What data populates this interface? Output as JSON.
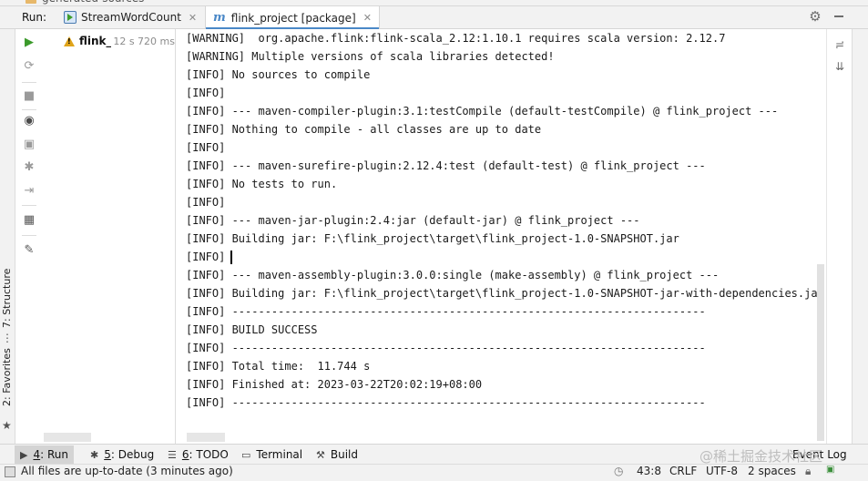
{
  "top": {
    "cut_text": "generated-sources"
  },
  "run_panel": {
    "label": "Run:",
    "tabs": [
      {
        "label": "StreamWordCount",
        "close": "✕"
      },
      {
        "label": "flink_project [package]",
        "close": "✕"
      }
    ]
  },
  "tree": {
    "name": "flink_p",
    "time": "12 s 720 ms"
  },
  "side": {
    "structure": "7: Structure",
    "favorites": "2: Favorites"
  },
  "console": {
    "lines": [
      "[WARNING]  org.apache.flink:flink-scala_2.12:1.10.1 requires scala version: 2.12.7",
      "[WARNING] Multiple versions of scala libraries detected!",
      "[INFO] No sources to compile",
      "[INFO]",
      "[INFO] --- maven-compiler-plugin:3.1:testCompile (default-testCompile) @ flink_project ---",
      "[INFO] Nothing to compile - all classes are up to date",
      "[INFO]",
      "[INFO] --- maven-surefire-plugin:2.12.4:test (default-test) @ flink_project ---",
      "[INFO] No tests to run.",
      "[INFO]",
      "[INFO] --- maven-jar-plugin:2.4:jar (default-jar) @ flink_project ---",
      "[INFO] Building jar: F:\\flink_project\\target\\flink_project-1.0-SNAPSHOT.jar",
      "[INFO]",
      "[INFO] --- maven-assembly-plugin:3.0.0:single (make-assembly) @ flink_project ---",
      "[INFO] Building jar: F:\\flink_project\\target\\flink_project-1.0-SNAPSHOT-jar-with-dependencies.jar",
      "[INFO] ------------------------------------------------------------------------",
      "[INFO] BUILD SUCCESS",
      "[INFO] ------------------------------------------------------------------------",
      "[INFO] Total time:  11.744 s",
      "[INFO] Finished at: 2023-03-22T20:02:19+08:00",
      "[INFO] ------------------------------------------------------------------------"
    ]
  },
  "tool_windows": [
    {
      "key": "4",
      "label": ": Run"
    },
    {
      "key": "5",
      "label": ": Debug"
    },
    {
      "key": "6",
      "label": ": TODO"
    },
    {
      "key": "",
      "label": "Terminal"
    },
    {
      "key": "",
      "label": "Build"
    }
  ],
  "event_log": "Event Log",
  "status": {
    "message": "All files are up-to-date (3 minutes ago)",
    "position": "43:8",
    "line_sep": "CRLF",
    "encoding": "UTF-8",
    "indent": "2 spaces"
  },
  "watermark": "@稀土掘金技术社区"
}
